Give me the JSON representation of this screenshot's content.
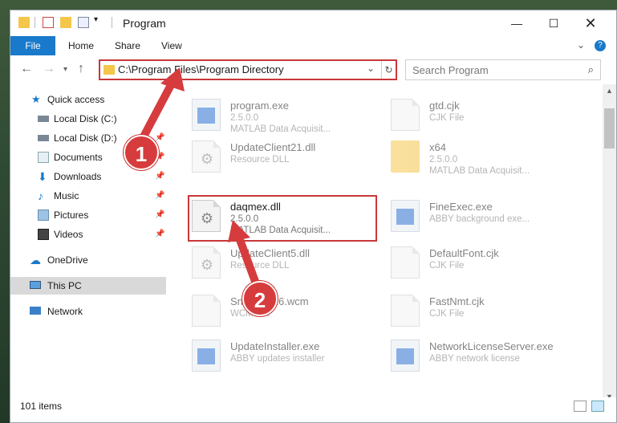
{
  "window": {
    "title": "Program"
  },
  "ribbon": {
    "tabs": [
      "File",
      "Home",
      "Share",
      "View"
    ]
  },
  "address": {
    "path": "C:\\Program Files\\Program Directory",
    "search_placeholder": "Search Program"
  },
  "sidebar": {
    "items": [
      {
        "label": "Quick access",
        "icon": "star-icon"
      },
      {
        "label": "Local Disk (C:)",
        "icon": "drive-icon"
      },
      {
        "label": "Local Disk (D:)",
        "icon": "drive-icon"
      },
      {
        "label": "Documents",
        "icon": "document-icon"
      },
      {
        "label": "Downloads",
        "icon": "download-icon"
      },
      {
        "label": "Music",
        "icon": "music-icon"
      },
      {
        "label": "Pictures",
        "icon": "pictures-icon"
      },
      {
        "label": "Videos",
        "icon": "video-icon"
      },
      {
        "label": "OneDrive",
        "icon": "cloud-icon"
      },
      {
        "label": "This PC",
        "icon": "computer-icon"
      },
      {
        "label": "Network",
        "icon": "network-icon"
      }
    ]
  },
  "files": [
    {
      "name": "program.exe",
      "line1": "2.5.0.0",
      "line2": "MATLAB Data Acquisit...",
      "icon": "app-icon"
    },
    {
      "name": "gtd.cjk",
      "line1": "CJK File",
      "line2": "",
      "icon": "file-icon"
    },
    {
      "name": "UpdateClient21.dll",
      "line1": "Resource DLL",
      "line2": "",
      "icon": "dll-icon"
    },
    {
      "name": "x64",
      "line1": "2.5.0.0",
      "line2": "MATLAB Data Acquisit...",
      "icon": "folder-icon"
    },
    {
      "name": "daqmex.dll",
      "line1": "2.5.0.0",
      "line2": "MATLAB Data Acquisit...",
      "icon": "dll-icon"
    },
    {
      "name": "FineExec.exe",
      "line1": "ABBY background exe...",
      "line2": "",
      "icon": "app-icon"
    },
    {
      "name": "UpdateClient5.dll",
      "line1": "Resource DLL",
      "line2": "",
      "icon": "dll-icon"
    },
    {
      "name": "DefaultFont.cjk",
      "line1": "CJK File",
      "line2": "",
      "icon": "file-icon"
    },
    {
      "name": "SndDll2016.wcm",
      "line1": "WCM File",
      "line2": "",
      "icon": "file-icon"
    },
    {
      "name": "FastNmt.cjk",
      "line1": "CJK File",
      "line2": "",
      "icon": "file-icon"
    },
    {
      "name": "UpdateInstaller.exe",
      "line1": "ABBY updates installer",
      "line2": "",
      "icon": "app-icon"
    },
    {
      "name": "NetworkLicenseServer.exe",
      "line1": "ABBY network license",
      "line2": "",
      "icon": "app-icon"
    }
  ],
  "status": {
    "count": "101 items"
  },
  "steps": [
    "1",
    "2"
  ]
}
